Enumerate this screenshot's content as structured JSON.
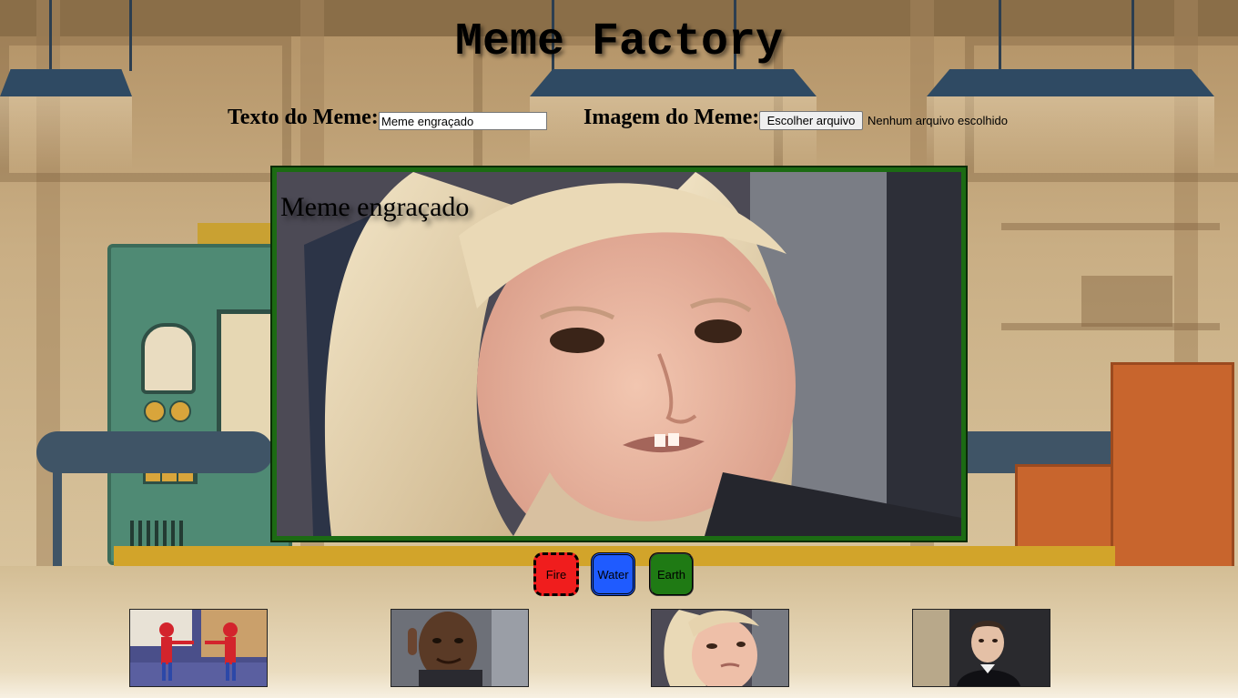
{
  "page": {
    "title": "Meme Factory"
  },
  "controls": {
    "text_label": "Texto do Meme:",
    "text_value": "Meme engraçado",
    "image_label": "Imagem do Meme:",
    "file_button_label": "Escolher arquivo",
    "file_status": "Nenhum arquivo escolhido"
  },
  "meme": {
    "caption": "Meme engraçado",
    "image": "side-eye-girl-photo",
    "border_color": "#1c6b13"
  },
  "border_buttons": [
    {
      "label": "Fire",
      "color": "#f01d1d",
      "style": "dashed"
    },
    {
      "label": "Water",
      "color": "#1f5bff",
      "style": "double"
    },
    {
      "label": "Earth",
      "color": "#1f7a14",
      "style": "groove"
    }
  ],
  "presets": [
    {
      "image": "spiderman-pointing-thumbnail"
    },
    {
      "image": "roll-safe-thumbnail"
    },
    {
      "image": "side-eye-girl-thumbnail"
    },
    {
      "image": "businessman-look-thumbnail"
    }
  ]
}
